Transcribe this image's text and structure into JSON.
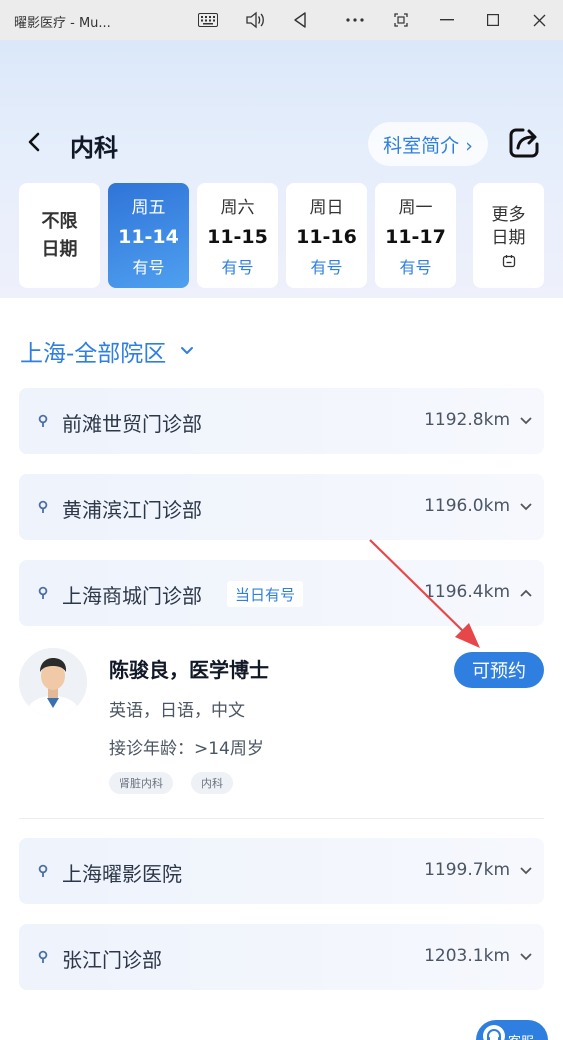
{
  "window": {
    "title": "曜影医疗 - Mu..."
  },
  "header": {
    "title": "内科",
    "intro_label": "科室简介 ›"
  },
  "dates": {
    "unlimited_label_1": "不限",
    "unlimited_label_2": "日期",
    "days": [
      {
        "weekday": "周五",
        "date": "11-14",
        "availability": "有号",
        "selected": true
      },
      {
        "weekday": "周六",
        "date": "11-15",
        "availability": "有号",
        "selected": false
      },
      {
        "weekday": "周日",
        "date": "11-16",
        "availability": "有号",
        "selected": false
      },
      {
        "weekday": "周一",
        "date": "11-17",
        "availability": "有号",
        "selected": false
      }
    ],
    "more_label_1": "更多",
    "more_label_2": "日期"
  },
  "region": {
    "label": "上海-全部院区"
  },
  "branches": [
    {
      "name": "前滩世贸门诊部",
      "distance": "1192.8km",
      "expanded": false
    },
    {
      "name": "黄浦滨江门诊部",
      "distance": "1196.0km",
      "expanded": false
    },
    {
      "name": "上海商城门诊部",
      "distance": "1196.4km",
      "expanded": true,
      "badge": "当日有号"
    },
    {
      "name": "上海曜影医院",
      "distance": "1199.7km",
      "expanded": false
    },
    {
      "name": "张江门诊部",
      "distance": "1203.1km",
      "expanded": false
    }
  ],
  "doctor": {
    "name": "陈骏良，医学博士",
    "languages": "英语，日语，中文",
    "age_range": "接诊年龄：>14周岁",
    "tags": [
      "肾脏内科",
      "内科"
    ],
    "book_label": "可预约"
  },
  "float_button": {
    "label": "客服"
  },
  "colors": {
    "accent": "#2f7fe0",
    "annotation_arrow": "#e8474a"
  }
}
